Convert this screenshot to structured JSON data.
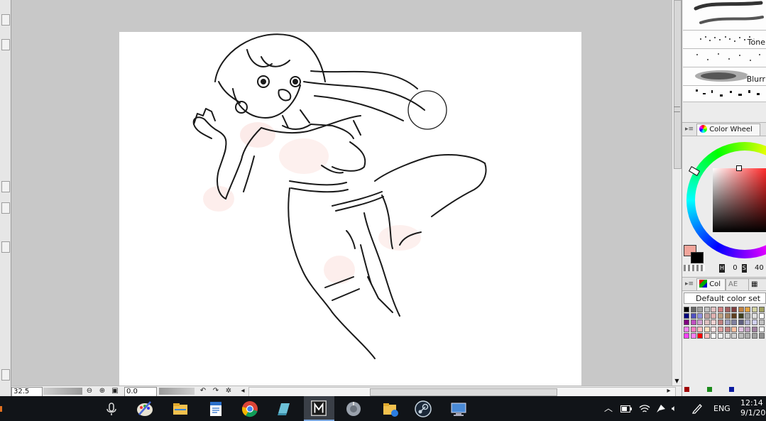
{
  "status_bar": {
    "zoom": "32.5",
    "rotation": "0.0"
  },
  "brushes": [
    {
      "label": ""
    },
    {
      "label": "Tone"
    },
    {
      "label": "Blurr"
    },
    {
      "label": ""
    }
  ],
  "color_wheel_panel": {
    "tab_label": "Color Wheel",
    "h_label": "H",
    "h_value": "0",
    "s_label": "S",
    "s_value": "40",
    "primary_color": "#f2a59b",
    "secondary_color": "#000000"
  },
  "color_set_panel": {
    "tab_label": "Col",
    "tab2_label": "AE",
    "selected_set": "Default color set",
    "bottom_colors": [
      "#a00000",
      "#1a8a1a",
      "#0a1aa0"
    ]
  },
  "taskbar": {
    "icons": [
      "mic-icon",
      "paint-tool-sai-icon",
      "file-explorer-icon",
      "notepad-icon",
      "chrome-icon",
      "notes-icon",
      "app-m-icon",
      "speaker-app-icon",
      "folder-cloud-icon",
      "steam-icon",
      "remote-desktop-icon"
    ],
    "language": "ENG",
    "time": "12:14 P",
    "date": "9/1/20"
  },
  "colors": {
    "canvas_bg": "#c8c8c8",
    "paper": "#ffffff",
    "taskbar_bg": "#111418"
  }
}
